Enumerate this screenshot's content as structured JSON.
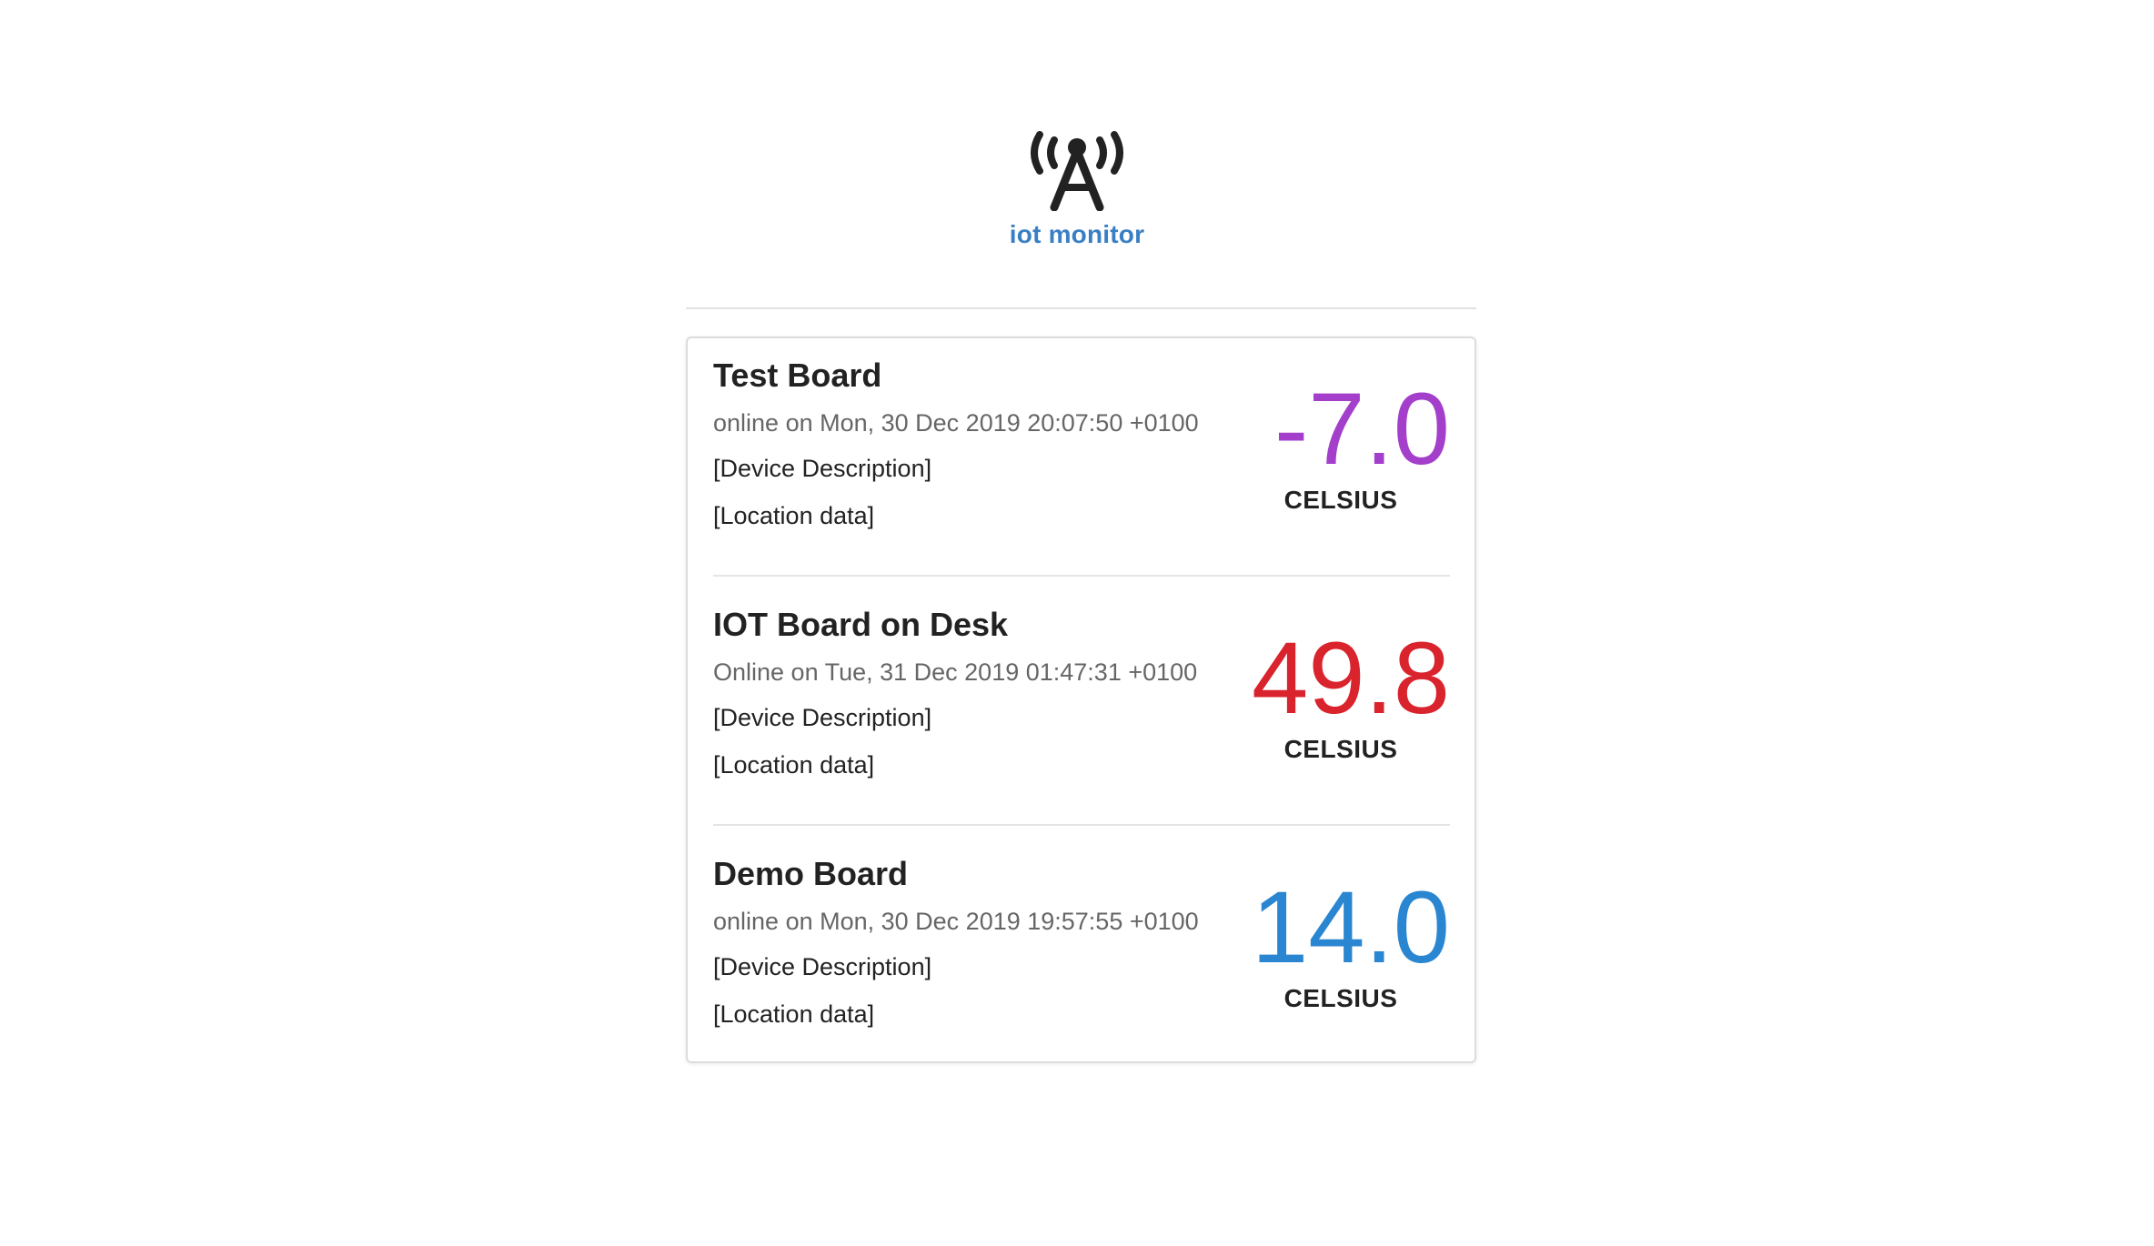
{
  "header": {
    "logo_icon": "antenna-broadcast-icon",
    "title": "iot monitor",
    "title_color": "#3a7fc4"
  },
  "devices": [
    {
      "name": "Test Board",
      "status": "online on Mon, 30 Dec 2019 20:07:50 +0100",
      "description": "[Device Description]",
      "location": "[Location data]",
      "temperature": "-7.0",
      "unit": "CELSIUS",
      "temp_color": "#a33fcb"
    },
    {
      "name": "IOT Board on Desk",
      "status": "Online on Tue, 31 Dec 2019 01:47:31 +0100",
      "description": "[Device Description]",
      "location": "[Location data]",
      "temperature": "49.8",
      "unit": "CELSIUS",
      "temp_color": "#d9232d"
    },
    {
      "name": "Demo Board",
      "status": "online on Mon, 30 Dec 2019 19:57:55 +0100",
      "description": "[Device Description]",
      "location": "[Location data]",
      "temperature": "14.0",
      "unit": "CELSIUS",
      "temp_color": "#2a86d1"
    }
  ]
}
